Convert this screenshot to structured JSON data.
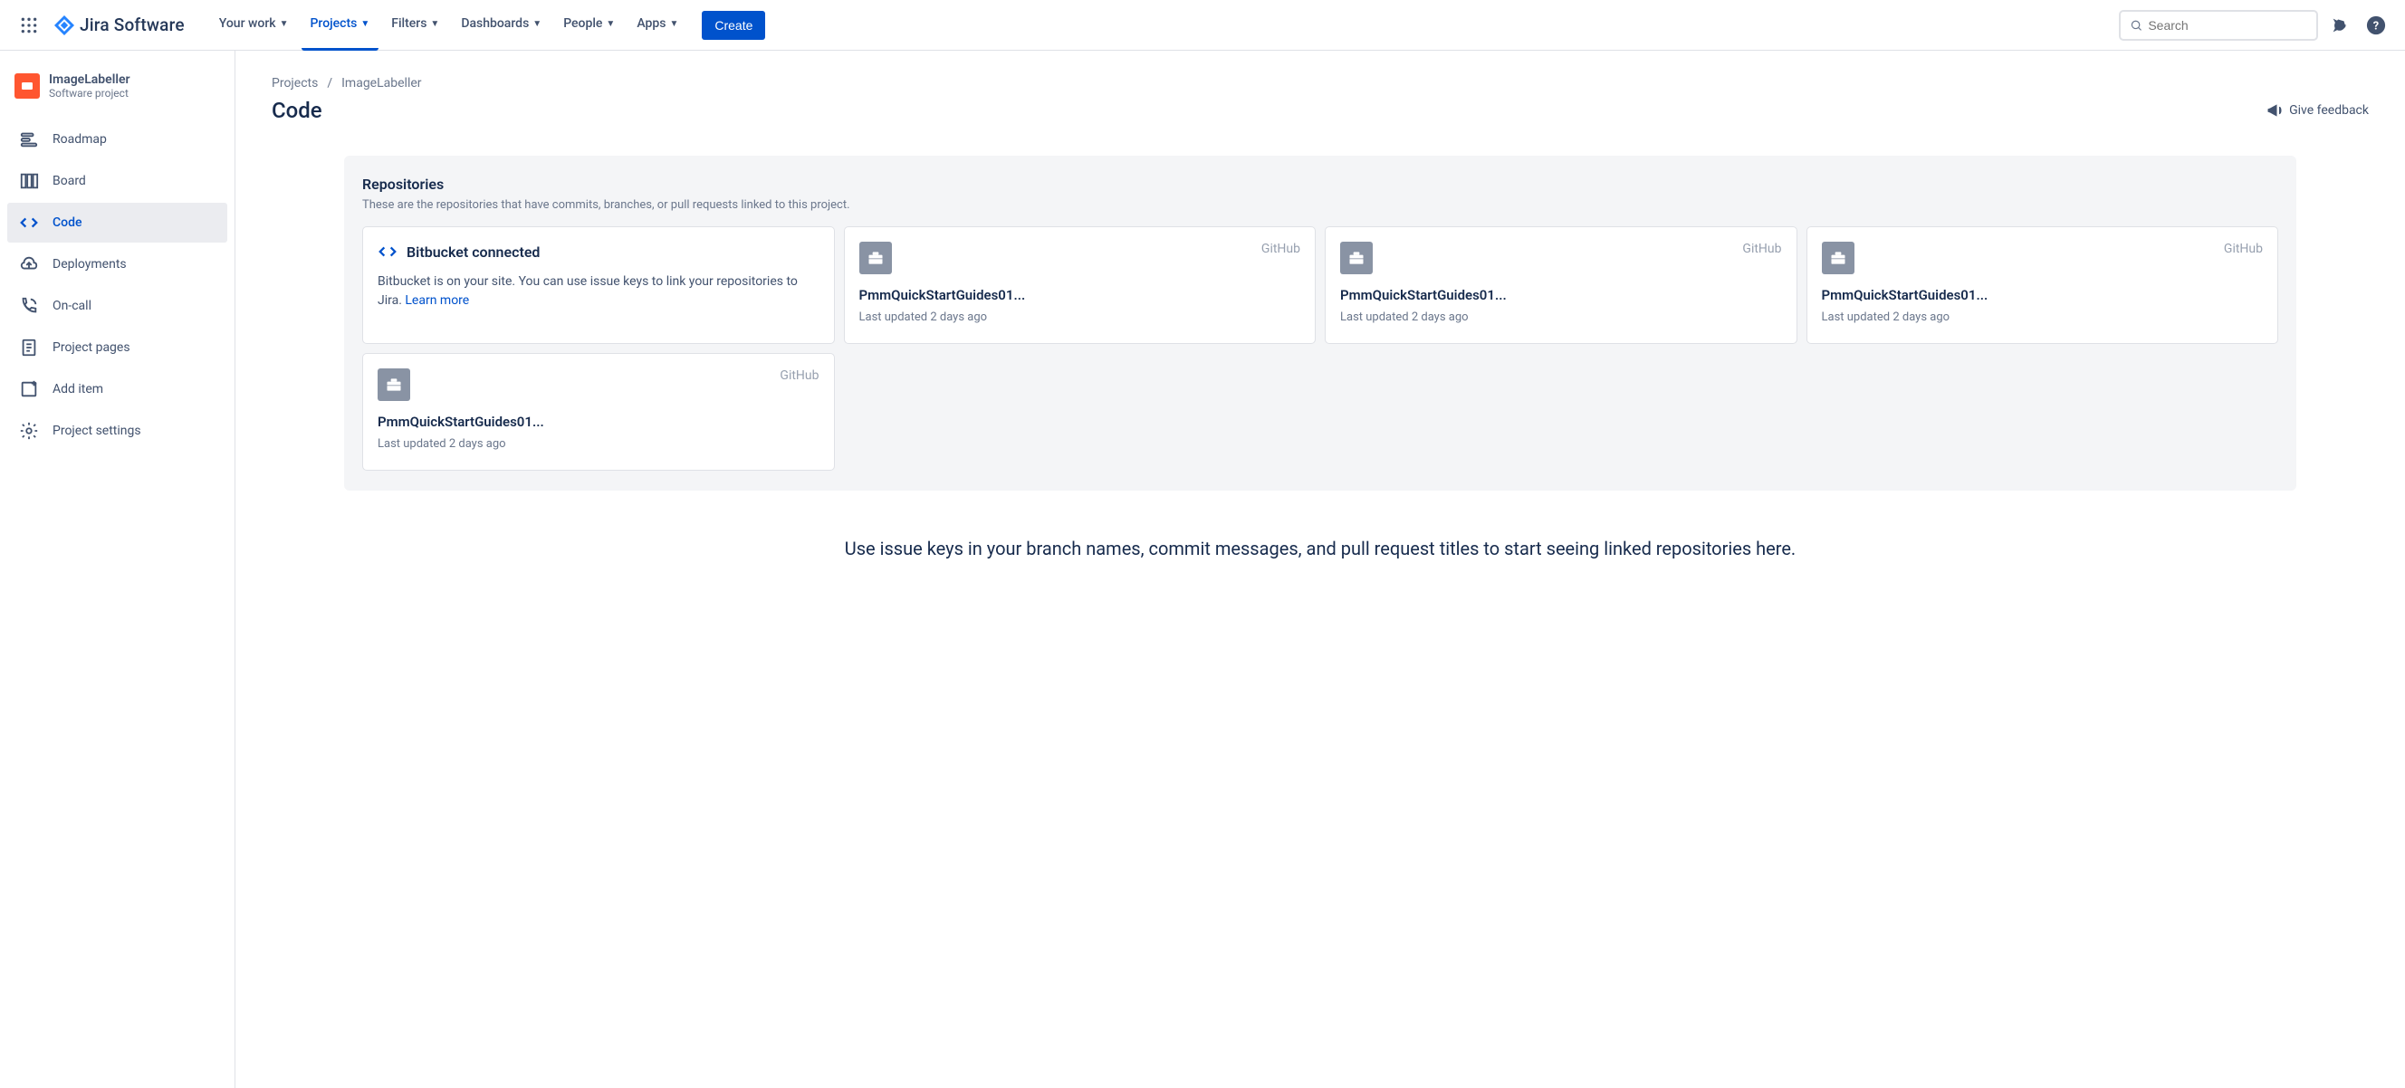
{
  "brand": "Jira Software",
  "nav": {
    "your_work": "Your work",
    "projects": "Projects",
    "filters": "Filters",
    "dashboards": "Dashboards",
    "people": "People",
    "apps": "Apps",
    "create": "Create"
  },
  "search_placeholder": "Search",
  "project": {
    "name": "ImageLabeller",
    "type": "Software project"
  },
  "sidebar": {
    "roadmap": "Roadmap",
    "board": "Board",
    "code": "Code",
    "deployments": "Deployments",
    "oncall": "On-call",
    "project_pages": "Project pages",
    "add_item": "Add item",
    "project_settings": "Project settings"
  },
  "breadcrumb": {
    "projects": "Projects",
    "current": "ImageLabeller"
  },
  "page_title": "Code",
  "feedback_label": "Give feedback",
  "repos": {
    "title": "Repositories",
    "description": "These are the repositories that have commits, branches, or pull requests linked to this project.",
    "bitbucket": {
      "title": "Bitbucket connected",
      "desc": "Bitbucket is on your site. You can use issue keys to link your repositories to Jira. ",
      "link": "Learn more"
    },
    "items": [
      {
        "source": "GitHub",
        "name": "PmmQuickStartGuides01...",
        "updated": "Last updated 2 days ago"
      },
      {
        "source": "GitHub",
        "name": "PmmQuickStartGuides01...",
        "updated": "Last updated 2 days ago"
      },
      {
        "source": "GitHub",
        "name": "PmmQuickStartGuides01...",
        "updated": "Last updated 2 days ago"
      },
      {
        "source": "GitHub",
        "name": "PmmQuickStartGuides01...",
        "updated": "Last updated 2 days ago"
      }
    ]
  },
  "hint": "Use issue keys in your branch names, commit messages, and pull request titles to start seeing linked repositories here."
}
